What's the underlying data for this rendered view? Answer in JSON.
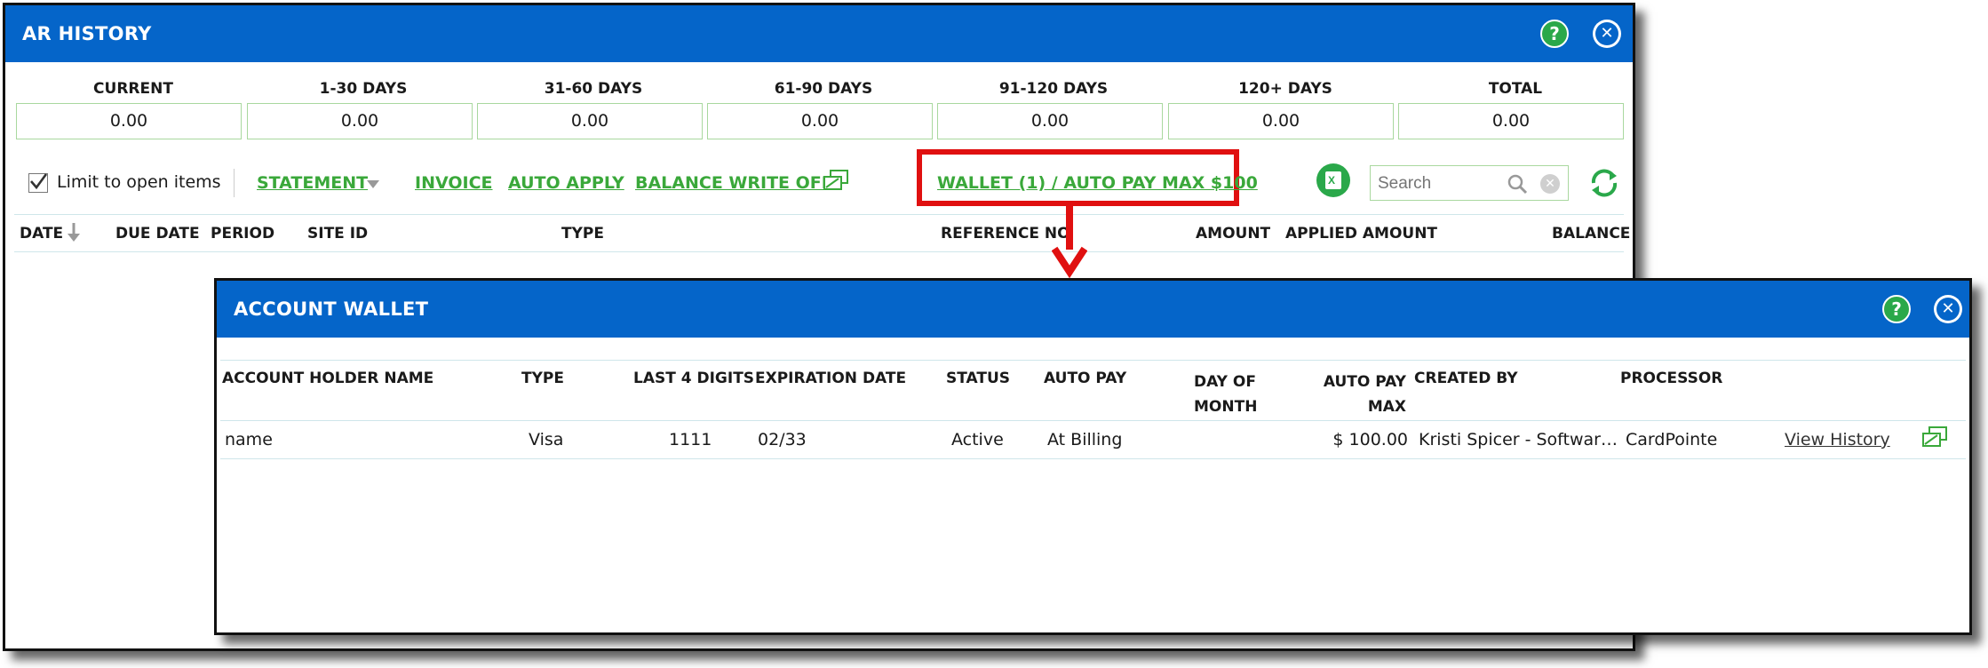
{
  "ar_history": {
    "title": "AR HISTORY",
    "aging": [
      {
        "label": "CURRENT",
        "value": "0.00"
      },
      {
        "label": "1-30 DAYS",
        "value": "0.00"
      },
      {
        "label": "31-60 DAYS",
        "value": "0.00"
      },
      {
        "label": "61-90 DAYS",
        "value": "0.00"
      },
      {
        "label": "91-120 DAYS",
        "value": "0.00"
      },
      {
        "label": "120+ DAYS",
        "value": "0.00"
      },
      {
        "label": "TOTAL",
        "value": "0.00"
      }
    ],
    "toolbar": {
      "limit_label": "Limit to open items",
      "limit_checked": true,
      "statement": "STATEMENT",
      "invoice": "INVOICE",
      "auto_apply": "AUTO APPLY",
      "balance_write_off": "BALANCE WRITE OFF",
      "wallet_link": "WALLET (1) / AUTO PAY MAX $100",
      "search_placeholder": "Search"
    },
    "columns": [
      "DATE",
      "DUE DATE",
      "PERIOD",
      "SITE ID",
      "TYPE",
      "REFERENCE NO",
      "AMOUNT",
      "APPLIED AMOUNT",
      "BALANCE"
    ]
  },
  "account_wallet": {
    "title": "ACCOUNT WALLET",
    "columns": {
      "holder": "ACCOUNT HOLDER NAME",
      "type": "TYPE",
      "last4": "LAST 4 DIGITS",
      "expiration": "EXPIRATION DATE",
      "status": "STATUS",
      "auto_pay": "AUTO PAY",
      "day_of_month_1": "DAY OF",
      "day_of_month_2": "MONTH",
      "auto_pay_max_1": "AUTO PAY",
      "auto_pay_max_2": "MAX",
      "created_by": "CREATED BY",
      "processor": "PROCESSOR"
    },
    "rows": [
      {
        "holder": "name",
        "type": "Visa",
        "last4": "1111",
        "expiration": "02/33",
        "status": "Active",
        "auto_pay": "At Billing",
        "day_of_month": "",
        "auto_pay_max": "$ 100.00",
        "created_by": "Kristi Spicer - Softwar…",
        "processor": "CardPointe",
        "view_history": "View History"
      }
    ]
  },
  "colors": {
    "titlebar": "#0565c9",
    "link_green": "#3aa83a",
    "highlight_red": "#e01010",
    "help_green": "#2aa84a"
  }
}
